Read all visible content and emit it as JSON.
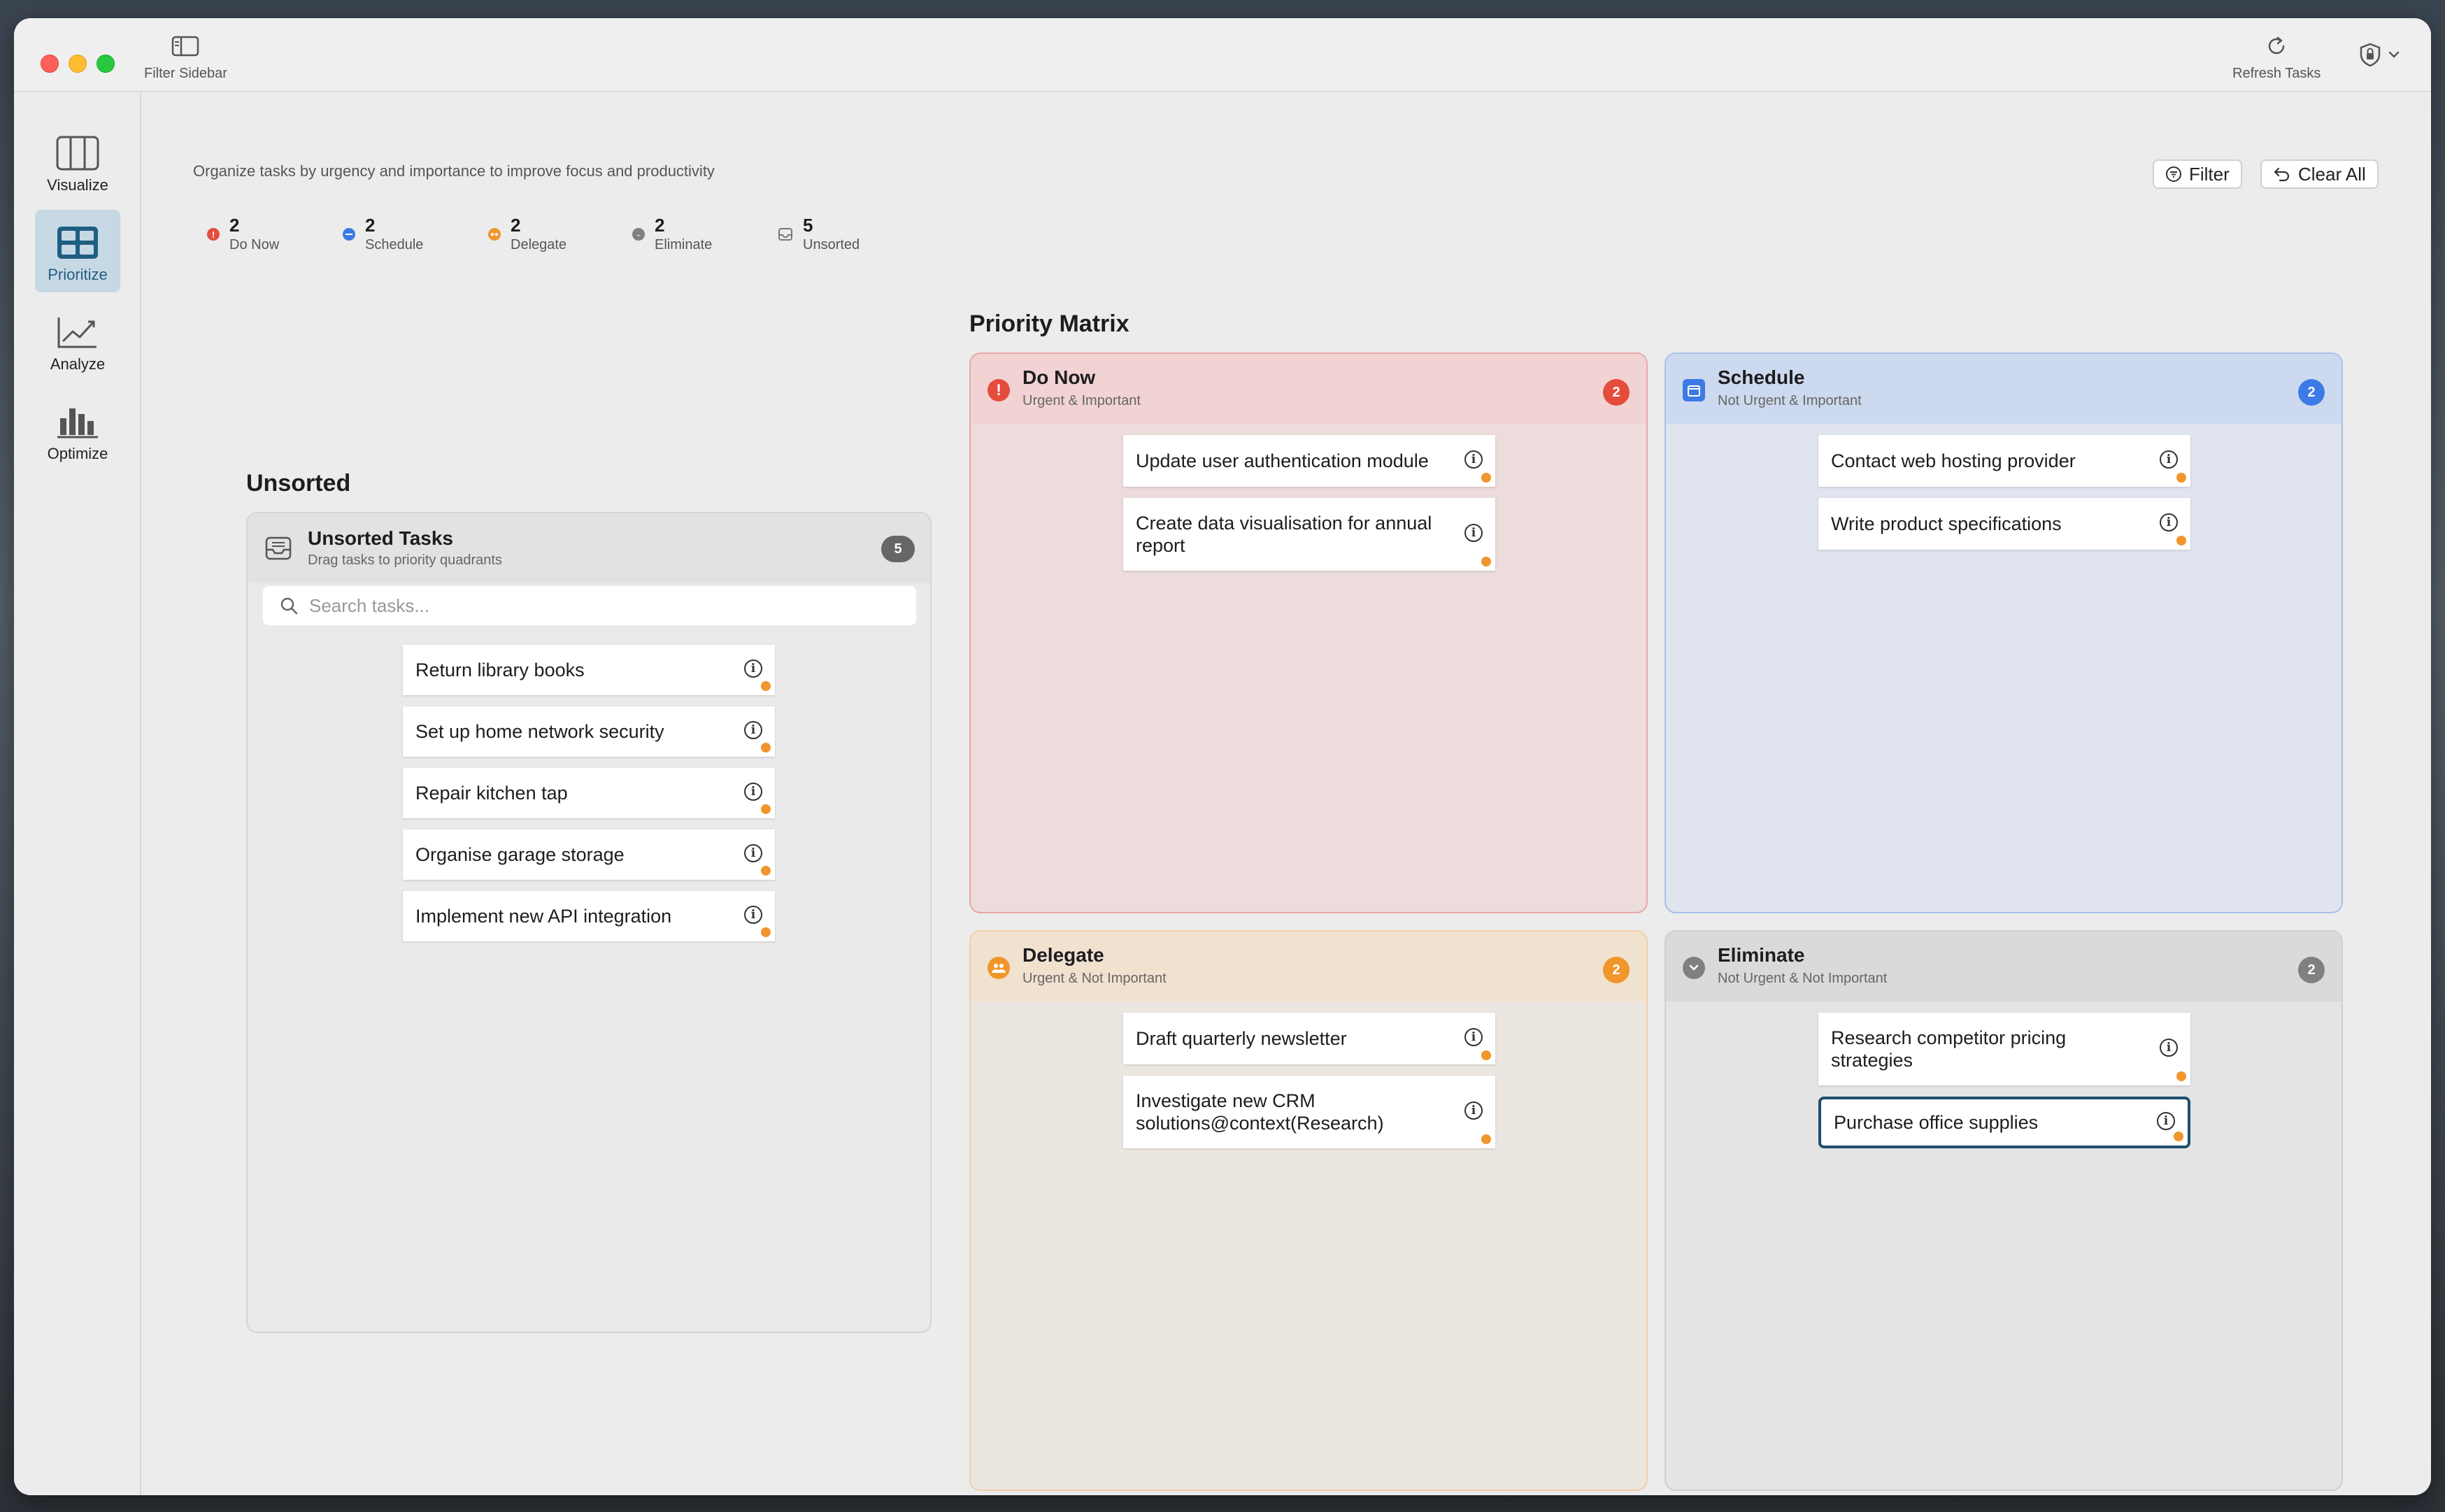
{
  "titlebar": {
    "filter_sidebar_label": "Filter Sidebar",
    "refresh_label": "Refresh Tasks",
    "account_icon": "shield-lock-icon"
  },
  "sidebar": {
    "items": [
      {
        "label": "Visualize",
        "icon": "columns-icon",
        "active": false
      },
      {
        "label": "Prioritize",
        "icon": "grid-icon",
        "active": true
      },
      {
        "label": "Analyze",
        "icon": "trend-chart-icon",
        "active": false
      },
      {
        "label": "Optimize",
        "icon": "bar-chart-icon",
        "active": false
      }
    ]
  },
  "header": {
    "subtitle": "Organize tasks by urgency and importance to improve focus and productivity",
    "filter_label": "Filter",
    "clear_label": "Clear All"
  },
  "summary": [
    {
      "count": "2",
      "label": "Do Now",
      "color": "#e64c3c",
      "bg": "#f0d5d5"
    },
    {
      "count": "2",
      "label": "Schedule",
      "color": "#3c7be6",
      "bg": "#d2dcef"
    },
    {
      "count": "2",
      "label": "Delegate",
      "color": "#f0962c",
      "bg": "#f2e0cb"
    },
    {
      "count": "2",
      "label": "Eliminate",
      "color": "#808080",
      "bg": "#dedede"
    },
    {
      "count": "5",
      "label": "Unsorted",
      "color": "#808080",
      "bg": "#e2e2e2"
    }
  ],
  "unsorted": {
    "section_title": "Unsorted",
    "box_title": "Unsorted Tasks",
    "box_subtitle": "Drag tasks to priority quadrants",
    "count": "5",
    "search_placeholder": "Search tasks...",
    "tasks": [
      "Return library books",
      "Set up home network security",
      "Repair kitchen tap",
      "Organise garage storage",
      "Implement new API integration"
    ]
  },
  "matrix": {
    "title": "Priority Matrix",
    "do_now": {
      "title": "Do Now",
      "subtitle": "Urgent & Important",
      "count": "2",
      "color": "#e64c3c",
      "tasks": [
        "Update user authentication module",
        "Create data visualisation for annual report"
      ]
    },
    "schedule": {
      "title": "Schedule",
      "subtitle": "Not Urgent & Important",
      "count": "2",
      "color": "#3c7be6",
      "tasks": [
        "Contact web hosting provider",
        "Write product specifications"
      ]
    },
    "delegate": {
      "title": "Delegate",
      "subtitle": "Urgent & Not Important",
      "count": "2",
      "color": "#f0962c",
      "tasks": [
        "Draft quarterly newsletter",
        "Investigate new CRM solutions@context(Research)"
      ]
    },
    "eliminate": {
      "title": "Eliminate",
      "subtitle": "Not Urgent & Not Important",
      "count": "2",
      "color": "#808080",
      "tasks": [
        "Research competitor pricing strategies",
        "Purchase office supplies"
      ]
    }
  }
}
